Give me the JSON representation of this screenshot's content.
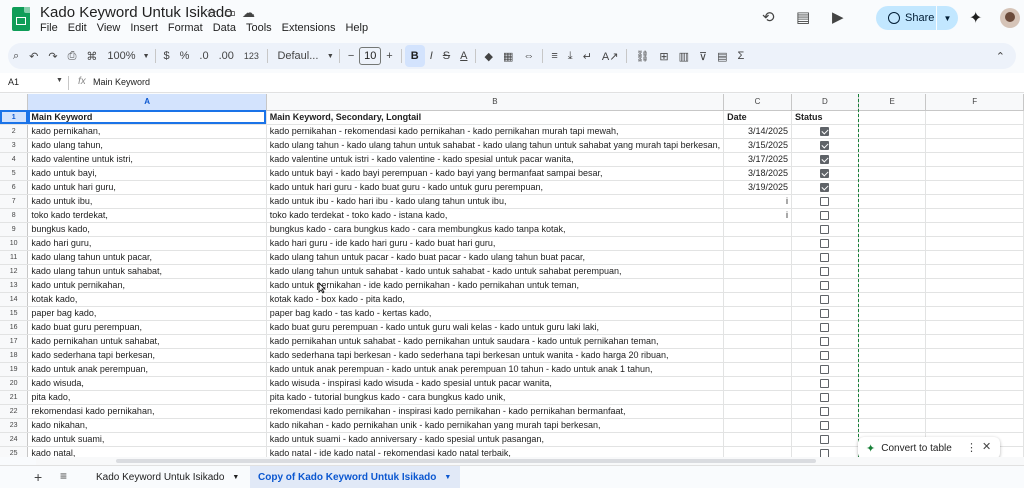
{
  "app": {
    "doc_title": "Kado Keyword Untuk Isikado",
    "menus": [
      "File",
      "Edit",
      "View",
      "Insert",
      "Format",
      "Data",
      "Tools",
      "Extensions",
      "Help"
    ],
    "share_label": "Share"
  },
  "toolbar": {
    "zoom": "100%",
    "currency": "$",
    "percent": "%",
    "dec_dec": ".0",
    "dec_inc": ".00",
    "format_123": "123",
    "font": "Defaul...",
    "font_size": "10",
    "bold": "B",
    "italic": "I",
    "text_color": "A"
  },
  "formula_bar": {
    "cell_ref": "A1",
    "fx": "fx",
    "value": "Main Keyword"
  },
  "columns": [
    "A",
    "B",
    "C",
    "D",
    "E",
    "F"
  ],
  "header_row": {
    "num": "1",
    "a": "Main Keyword",
    "b": "Main Keyword, Secondary, Longtail",
    "c": "Date",
    "d": "Status"
  },
  "rows": [
    {
      "num": "2",
      "a": "kado pernikahan,",
      "b": "kado pernikahan - rekomendasi kado pernikahan - kado pernikahan murah tapi mewah,",
      "c": "3/14/2025",
      "checked": true
    },
    {
      "num": "3",
      "a": "kado ulang tahun,",
      "b": "kado ulang tahun - kado ulang tahun untuk sahabat - kado ulang tahun untuk sahabat yang murah tapi berkesan,",
      "c": "3/15/2025",
      "checked": true
    },
    {
      "num": "4",
      "a": "kado valentine untuk istri,",
      "b": "kado valentine untuk istri - kado valentine - kado spesial untuk pacar wanita,",
      "c": "3/17/2025",
      "checked": true
    },
    {
      "num": "5",
      "a": "kado untuk bayi,",
      "b": "kado untuk bayi - kado bayi perempuan - kado bayi yang bermanfaat sampai besar,",
      "c": "3/18/2025",
      "checked": true
    },
    {
      "num": "6",
      "a": "kado untuk hari guru,",
      "b": "kado untuk hari guru - kado buat guru - kado untuk guru perempuan,",
      "c": "3/19/2025",
      "checked": true
    },
    {
      "num": "7",
      "a": "kado untuk ibu,",
      "b": "kado untuk ibu - kado hari ibu - kado ulang tahun untuk ibu,",
      "c": "i",
      "checked": false
    },
    {
      "num": "8",
      "a": "toko kado terdekat,",
      "b": "toko kado terdekat - toko kado - istana kado,",
      "c": "i",
      "checked": false
    },
    {
      "num": "9",
      "a": "bungkus kado,",
      "b": "bungkus kado - cara bungkus kado - cara membungkus kado tanpa kotak,",
      "c": "",
      "checked": false
    },
    {
      "num": "10",
      "a": "kado hari guru,",
      "b": "kado hari guru - ide kado hari guru - kado buat hari guru,",
      "c": "",
      "checked": false
    },
    {
      "num": "11",
      "a": "kado ulang tahun untuk pacar,",
      "b": "kado ulang tahun untuk pacar - kado buat pacar - kado ulang tahun buat pacar,",
      "c": "",
      "checked": false
    },
    {
      "num": "12",
      "a": "kado ulang tahun untuk sahabat,",
      "b": "kado ulang tahun untuk sahabat - kado untuk sahabat - kado untuk sahabat perempuan,",
      "c": "",
      "checked": false
    },
    {
      "num": "13",
      "a": "kado untuk pernikahan,",
      "b": "kado untuk pernikahan - ide kado pernikahan - kado pernikahan untuk teman,",
      "c": "",
      "checked": false
    },
    {
      "num": "14",
      "a": "kotak kado,",
      "b": "kotak kado - box kado - pita kado,",
      "c": "",
      "checked": false
    },
    {
      "num": "15",
      "a": "paper bag kado,",
      "b": "paper bag kado - tas kado - kertas kado,",
      "c": "",
      "checked": false
    },
    {
      "num": "16",
      "a": "kado buat guru perempuan,",
      "b": "kado buat guru perempuan - kado untuk guru wali kelas - kado untuk guru laki laki,",
      "c": "",
      "checked": false
    },
    {
      "num": "17",
      "a": "kado pernikahan untuk sahabat,",
      "b": "kado pernikahan untuk sahabat - kado pernikahan untuk saudara - kado untuk pernikahan teman,",
      "c": "",
      "checked": false
    },
    {
      "num": "18",
      "a": "kado sederhana tapi berkesan,",
      "b": "kado sederhana tapi berkesan - kado sederhana tapi berkesan untuk wanita - kado harga 20 ribuan,",
      "c": "",
      "checked": false
    },
    {
      "num": "19",
      "a": "kado untuk anak perempuan,",
      "b": "kado untuk anak perempuan - kado untuk anak perempuan 10 tahun - kado untuk anak 1 tahun,",
      "c": "",
      "checked": false
    },
    {
      "num": "20",
      "a": "kado wisuda,",
      "b": "kado wisuda - inspirasi kado wisuda - kado spesial untuk pacar wanita,",
      "c": "",
      "checked": false
    },
    {
      "num": "21",
      "a": "pita kado,",
      "b": "pita kado - tutorial bungkus kado - cara bungkus kado unik,",
      "c": "",
      "checked": false
    },
    {
      "num": "22",
      "a": "rekomendasi kado pernikahan,",
      "b": "rekomendasi kado pernikahan - inspirasi kado pernikahan - kado pernikahan bermanfaat,",
      "c": "",
      "checked": false
    },
    {
      "num": "23",
      "a": "kado nikahan,",
      "b": "kado nikahan - kado pernikahan unik - kado pernikahan yang murah tapi berkesan,",
      "c": "",
      "checked": false
    },
    {
      "num": "24",
      "a": "kado untuk suami,",
      "b": "kado untuk suami - kado anniversary - kado spesial untuk pasangan,",
      "c": "",
      "checked": false
    },
    {
      "num": "25",
      "a": "kado natal,",
      "b": "kado natal - ide kado natal - rekomendasi kado natal terbaik,",
      "c": "",
      "checked": false
    }
  ],
  "convert_chip": {
    "label": "Convert to table"
  },
  "sheets": [
    {
      "name": "Kado Keyword Untuk Isikado",
      "active": false
    },
    {
      "name": "Copy of Kado Keyword Untuk Isikado",
      "active": true
    }
  ],
  "colors": {
    "accent": "#0b57d0",
    "share_bg": "#c2e7ff",
    "selection": "#d3e3fd",
    "sheets_green": "#0f9d58"
  }
}
